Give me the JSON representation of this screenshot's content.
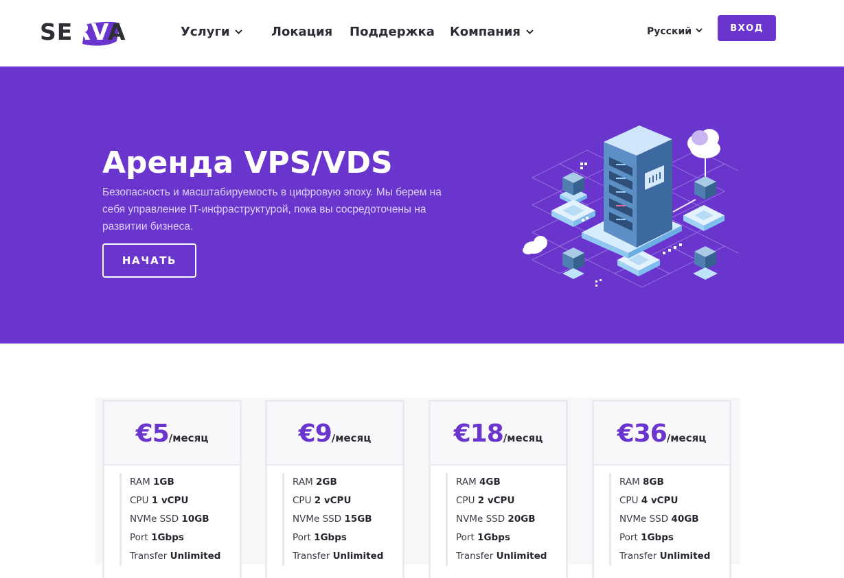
{
  "brand": {
    "name": "SERVA",
    "parts": [
      "SE",
      "RV",
      "A"
    ],
    "accent": "#6a35cc"
  },
  "nav": {
    "items": [
      {
        "label": "Услуги",
        "has_dropdown": true
      },
      {
        "label": "Локация",
        "has_dropdown": false
      },
      {
        "label": "Поддержка",
        "has_dropdown": false
      },
      {
        "label": "Компания",
        "has_dropdown": true
      }
    ],
    "language": "Русский",
    "login_label": "ВХОД"
  },
  "hero": {
    "title": "Аренда VPS/VDS",
    "subtitle": "Безопасность и масштабируемость в цифровую эпоху. Мы берем на себя управление IT-инфраструктурой, пока вы сосредоточены на развитии бизнеса.",
    "cta_label": "НАЧАТЬ",
    "background": "#6a35cc",
    "illustration": "server-rack-network-illustration"
  },
  "plans": [
    {
      "price": "€5",
      "period": "/месяц",
      "specs": [
        {
          "name": "RAM",
          "value": "1GB"
        },
        {
          "name": "CPU",
          "value": "1 vCPU"
        },
        {
          "name": "NVMe SSD",
          "value": "10GB"
        },
        {
          "name": "Port",
          "value": "1Gbps"
        },
        {
          "name": "Transfer",
          "value": "Unlimited"
        }
      ]
    },
    {
      "price": "€9",
      "period": "/месяц",
      "specs": [
        {
          "name": "RAM",
          "value": "2GB"
        },
        {
          "name": "CPU",
          "value": "2 vCPU"
        },
        {
          "name": "NVMe SSD",
          "value": "15GB"
        },
        {
          "name": "Port",
          "value": "1Gbps"
        },
        {
          "name": "Transfer",
          "value": "Unlimited"
        }
      ]
    },
    {
      "price": "€18",
      "period": "/месяц",
      "specs": [
        {
          "name": "RAM",
          "value": "4GB"
        },
        {
          "name": "CPU",
          "value": "2 vCPU"
        },
        {
          "name": "NVMe SSD",
          "value": "20GB"
        },
        {
          "name": "Port",
          "value": "1Gbps"
        },
        {
          "name": "Transfer",
          "value": "Unlimited"
        }
      ]
    },
    {
      "price": "€36",
      "period": "/месяц",
      "specs": [
        {
          "name": "RAM",
          "value": "8GB"
        },
        {
          "name": "CPU",
          "value": "4 vCPU"
        },
        {
          "name": "NVMe SSD",
          "value": "40GB"
        },
        {
          "name": "Port",
          "value": "1Gbps"
        },
        {
          "name": "Transfer",
          "value": "Unlimited"
        }
      ]
    }
  ]
}
